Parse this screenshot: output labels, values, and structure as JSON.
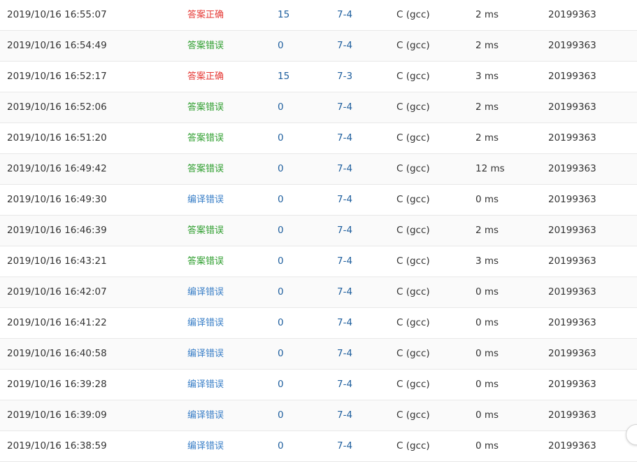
{
  "submissions": [
    {
      "time": "2019/10/16 16:55:07",
      "status": "答案正确",
      "status_kind": "accepted",
      "score": "15",
      "problem": "7-4",
      "language": "C (gcc)",
      "runtime": "2 ms",
      "user": "20199363"
    },
    {
      "time": "2019/10/16 16:54:49",
      "status": "答案错误",
      "status_kind": "wrong",
      "score": "0",
      "problem": "7-4",
      "language": "C (gcc)",
      "runtime": "2 ms",
      "user": "20199363"
    },
    {
      "time": "2019/10/16 16:52:17",
      "status": "答案正确",
      "status_kind": "accepted",
      "score": "15",
      "problem": "7-3",
      "language": "C (gcc)",
      "runtime": "3 ms",
      "user": "20199363"
    },
    {
      "time": "2019/10/16 16:52:06",
      "status": "答案错误",
      "status_kind": "wrong",
      "score": "0",
      "problem": "7-4",
      "language": "C (gcc)",
      "runtime": "2 ms",
      "user": "20199363"
    },
    {
      "time": "2019/10/16 16:51:20",
      "status": "答案错误",
      "status_kind": "wrong",
      "score": "0",
      "problem": "7-4",
      "language": "C (gcc)",
      "runtime": "2 ms",
      "user": "20199363"
    },
    {
      "time": "2019/10/16 16:49:42",
      "status": "答案错误",
      "status_kind": "wrong",
      "score": "0",
      "problem": "7-4",
      "language": "C (gcc)",
      "runtime": "12 ms",
      "user": "20199363"
    },
    {
      "time": "2019/10/16 16:49:30",
      "status": "编译错误",
      "status_kind": "compile",
      "score": "0",
      "problem": "7-4",
      "language": "C (gcc)",
      "runtime": "0 ms",
      "user": "20199363"
    },
    {
      "time": "2019/10/16 16:46:39",
      "status": "答案错误",
      "status_kind": "wrong",
      "score": "0",
      "problem": "7-4",
      "language": "C (gcc)",
      "runtime": "2 ms",
      "user": "20199363"
    },
    {
      "time": "2019/10/16 16:43:21",
      "status": "答案错误",
      "status_kind": "wrong",
      "score": "0",
      "problem": "7-4",
      "language": "C (gcc)",
      "runtime": "3 ms",
      "user": "20199363"
    },
    {
      "time": "2019/10/16 16:42:07",
      "status": "编译错误",
      "status_kind": "compile",
      "score": "0",
      "problem": "7-4",
      "language": "C (gcc)",
      "runtime": "0 ms",
      "user": "20199363"
    },
    {
      "time": "2019/10/16 16:41:22",
      "status": "编译错误",
      "status_kind": "compile",
      "score": "0",
      "problem": "7-4",
      "language": "C (gcc)",
      "runtime": "0 ms",
      "user": "20199363"
    },
    {
      "time": "2019/10/16 16:40:58",
      "status": "编译错误",
      "status_kind": "compile",
      "score": "0",
      "problem": "7-4",
      "language": "C (gcc)",
      "runtime": "0 ms",
      "user": "20199363"
    },
    {
      "time": "2019/10/16 16:39:28",
      "status": "编译错误",
      "status_kind": "compile",
      "score": "0",
      "problem": "7-4",
      "language": "C (gcc)",
      "runtime": "0 ms",
      "user": "20199363"
    },
    {
      "time": "2019/10/16 16:39:09",
      "status": "编译错误",
      "status_kind": "compile",
      "score": "0",
      "problem": "7-4",
      "language": "C (gcc)",
      "runtime": "0 ms",
      "user": "20199363"
    },
    {
      "time": "2019/10/16 16:38:59",
      "status": "编译错误",
      "status_kind": "compile",
      "score": "0",
      "problem": "7-4",
      "language": "C (gcc)",
      "runtime": "0 ms",
      "user": "20199363"
    }
  ],
  "colors": {
    "accepted": "#e53935",
    "wrong": "#2e9e2e",
    "compile": "#3a7fc7",
    "link": "#1f5f9e",
    "row_alt": "#fafafa",
    "border": "#e8e8e8"
  }
}
